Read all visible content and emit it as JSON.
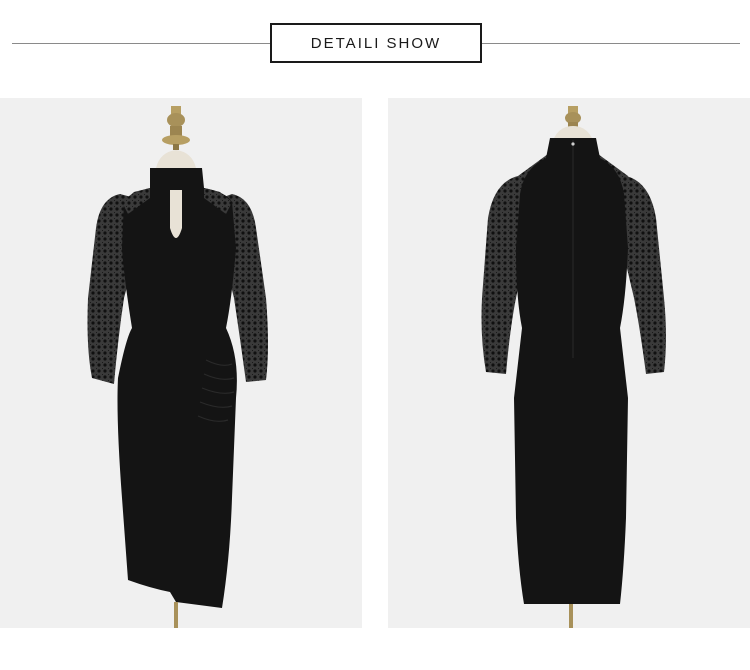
{
  "header": {
    "title": "DETAILI SHOW"
  },
  "photos": [
    {
      "view": "front",
      "description_icon": "dress-front-photo"
    },
    {
      "view": "back",
      "description_icon": "dress-back-photo"
    }
  ],
  "colors": {
    "background": "#ffffff",
    "photo_background": "#f0f0f0",
    "dress": "#141414",
    "lace": "#2a2a2a",
    "mannequin_finial": "#a8915a",
    "mannequin_neck": "#e8e2d6",
    "border": "#1a1a1a"
  }
}
